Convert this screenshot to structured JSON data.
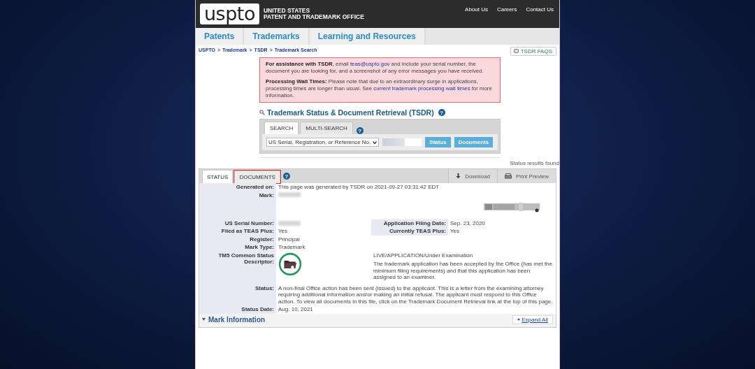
{
  "header": {
    "logo": "uspto",
    "org_lines": [
      "UNITED STATES",
      "PATENT AND TRADEMARK OFFICE"
    ],
    "links": [
      "About Us",
      "Careers",
      "Contact Us"
    ]
  },
  "nav": [
    "Patents",
    "Trademarks",
    "Learning and Resources"
  ],
  "breadcrumb": {
    "items": [
      "USPTO",
      "Trademark",
      "TSDR",
      "Trademark Search"
    ],
    "separator": ">"
  },
  "faq_button": "TSDR FAQS",
  "alert": {
    "paragraphs": [
      [
        {
          "kind": "bold",
          "text": "For assistance with TSDR"
        },
        {
          "kind": "plain",
          "text": ", email "
        },
        {
          "kind": "link",
          "text": "teas@uspto.gov"
        },
        {
          "kind": "plain",
          "text": " and include your serial number, the document you are looking for, and a screenshot of any error messages you have received."
        }
      ],
      [
        {
          "kind": "bold",
          "text": "Processing Wait Times:"
        },
        {
          "kind": "plain",
          "text": " Please note that due to an extraordinary surge in applications, processing times are longer than usual. See "
        },
        {
          "kind": "link",
          "text": "current trademark processing wait times"
        },
        {
          "kind": "plain",
          "text": " for more information."
        }
      ]
    ]
  },
  "tsdr": {
    "title": "Trademark Status & Document Retrieval (TSDR)",
    "help": "?",
    "tabs": [
      {
        "label": "SEARCH",
        "selected": true
      },
      {
        "label": "MULTI-SEARCH",
        "selected": false
      }
    ],
    "select": "US Serial, Registration, or Reference No.",
    "buttons": [
      "Status",
      "Documents"
    ]
  },
  "results_note": "Status results found",
  "status": {
    "tabs": [
      {
        "label": "STATUS",
        "selected": true,
        "highlighted": false
      },
      {
        "label": "DOCUMENTS",
        "selected": false,
        "highlighted": true
      }
    ],
    "help": "?",
    "actions": [
      {
        "kind": "download",
        "label": "Download"
      },
      {
        "kind": "print",
        "label": "Print Preview"
      }
    ],
    "rows": [
      {
        "kind": "field",
        "label": "Generated on:",
        "value": "This page was generated by TSDR on 2021-09-27 03:31:42 EDT"
      },
      {
        "kind": "mark",
        "label": "Mark:"
      },
      {
        "kind": "pair",
        "label": "US Serial Number:",
        "redacted": true,
        "label2": "Application Filing Date:",
        "value2": "Sep. 23, 2020"
      },
      {
        "kind": "pair",
        "label": "Filed as TEAS Plus:",
        "value": "Yes",
        "redacted": false,
        "label2": "Currently TEAS Plus:",
        "value2": "Yes"
      },
      {
        "kind": "field",
        "label": "Register:",
        "value": "Principal"
      },
      {
        "kind": "field",
        "label": "Mark Type:",
        "value": "Trademark"
      },
      {
        "kind": "descriptor",
        "label": "TM5 Common Status Descriptor:",
        "status": "LIVE/APPLICATION/Under Examination",
        "description": "The trademark application has been accepted by the Office (has met the minimum filing requirements) and that this application has been assigned to an examiner."
      },
      {
        "kind": "field",
        "label": "Status:",
        "value": "A non-final Office action has been sent (issued) to the applicant. This is a letter from the examining attorney requiring additional information and/or making an initial refusal. The applicant must respond to this Office action. To view all documents in this file, click on the Trademark Document Retrieval link at the top of this page."
      },
      {
        "kind": "field",
        "label": "Status Date:",
        "value": "Aug. 10, 2021"
      }
    ]
  },
  "section": {
    "title": "Mark Information",
    "expand": "Expand All"
  }
}
